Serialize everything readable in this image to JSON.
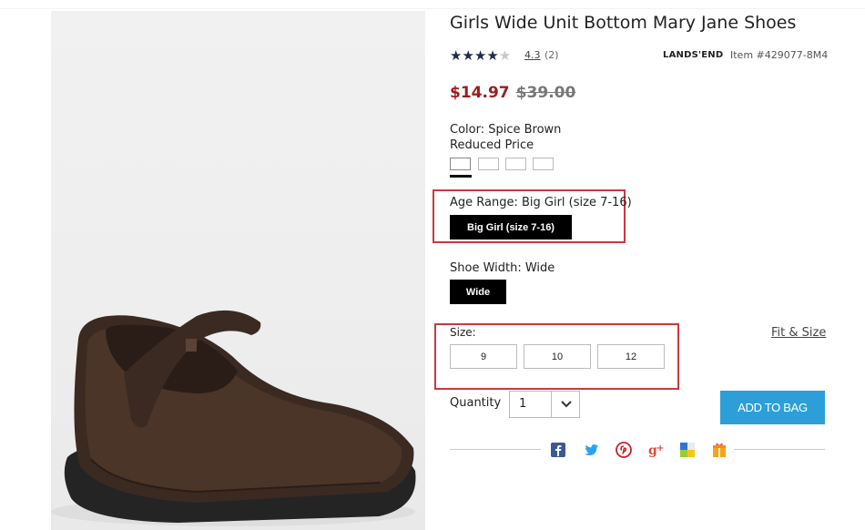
{
  "product": {
    "title": "Girls Wide Unit Bottom Mary Jane Shoes",
    "rating_value": "4.3",
    "rating_count": "(2)",
    "stars_filled": "★★★★",
    "stars_empty": "★",
    "brand": "LANDS'END",
    "item_number": "Item #429077-8M4",
    "image_icon": "mary-jane-shoe-photo"
  },
  "price": {
    "sale": "$14.97",
    "original": "$39.00"
  },
  "color": {
    "label": "Color: Spice Brown",
    "note": "Reduced Price",
    "swatch_count": 4
  },
  "age_range": {
    "label": "Age Range: Big Girl (size 7-16)",
    "selected_option": "Big Girl (size 7-16)"
  },
  "shoe_width": {
    "label": "Shoe Width: Wide",
    "selected_option": "Wide"
  },
  "size": {
    "label": "Size:",
    "fit_link": "Fit & Size",
    "options": [
      "9",
      "10",
      "12"
    ]
  },
  "quantity": {
    "label": "Quantity",
    "value": "1"
  },
  "cart": {
    "add_label": "ADD TO BAG",
    "accent_color": "#2c9fd9"
  },
  "share_icons": [
    "facebook-icon",
    "twitter-icon",
    "pinterest-icon",
    "google-plus-icon",
    "delicious-icon",
    "gift-icon"
  ],
  "highlight_color": "#c9393f",
  "sale_color": "#9b1c1c"
}
